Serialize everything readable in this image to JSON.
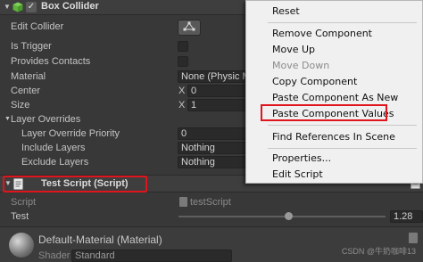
{
  "box_collider": {
    "title": "Box Collider",
    "enabled_mark": "✓",
    "rows": {
      "edit_collider": "Edit Collider",
      "is_trigger": "Is Trigger",
      "provides_contacts": "Provides Contacts",
      "material": "Material",
      "material_value": "None (Physic M",
      "center": "Center",
      "size": "Size",
      "layer_overrides": "Layer Overrides",
      "layer_override_priority": "Layer Override Priority",
      "layer_override_priority_value": "0",
      "include_layers": "Include Layers",
      "include_layers_value": "Nothing",
      "exclude_layers": "Exclude Layers",
      "exclude_layers_value": "Nothing"
    },
    "axis_x": "X",
    "center_x": "0",
    "size_x": "1"
  },
  "test_script": {
    "title": "Test Script (Script)",
    "script_label": "Script",
    "script_value": "testScript",
    "test_label": "Test",
    "test_value": "1.28",
    "slider_fraction": 0.53
  },
  "material": {
    "name": "Default-Material (Material)",
    "shader_label": "Shader",
    "shader_value": "Standard"
  },
  "context_menu": {
    "items": [
      {
        "label": "Reset",
        "disabled": false
      },
      {
        "label": "Remove Component",
        "disabled": false
      },
      {
        "label": "Move Up",
        "disabled": false
      },
      {
        "label": "Move Down",
        "disabled": true
      },
      {
        "label": "Copy Component",
        "disabled": false
      },
      {
        "label": "Paste Component As New",
        "disabled": false
      },
      {
        "label": "Paste Component Values",
        "disabled": false
      },
      {
        "label": "Find References In Scene",
        "disabled": false
      },
      {
        "label": "Properties...",
        "disabled": false
      },
      {
        "label": "Edit Script",
        "disabled": false
      }
    ]
  },
  "colors": {
    "highlight": "#e0141c",
    "panel_bg": "#383838",
    "menu_bg": "#f0f0f0"
  },
  "watermark": "CSDN @牛奶咖啡13"
}
